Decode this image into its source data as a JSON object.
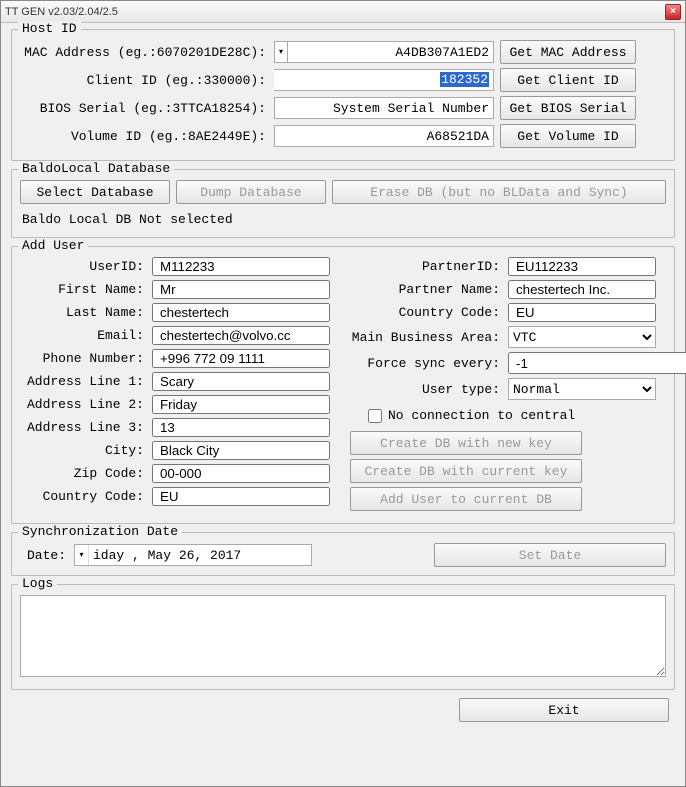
{
  "window_title": "TT GEN v2.03/2.04/2.5",
  "host": {
    "group_title": "Host ID",
    "mac_label": "MAC Address (eg.:6070201DE28C):",
    "mac_value": "A4DB307A1ED2",
    "mac_btn": "Get MAC Address",
    "client_label": "Client ID (eg.:330000):",
    "client_value": "182352",
    "client_btn": "Get Client ID",
    "bios_label": "BIOS Serial (eg.:3TTCA18254):",
    "bios_value": "System Serial Number",
    "bios_btn": "Get BIOS Serial",
    "vol_label": "Volume ID (eg.:8AE2449E):",
    "vol_value": "A68521DA",
    "vol_btn": "Get Volume ID"
  },
  "db": {
    "group_title": "BaldoLocal Database",
    "select_btn": "Select Database",
    "dump_btn": "Dump Database",
    "erase_btn": "Erase DB (but no BLData and Sync)",
    "status": "Baldo Local DB Not selected"
  },
  "adduser": {
    "group_title": "Add User",
    "labels": {
      "userid": "UserID:",
      "first": "First Name:",
      "last": "Last Name:",
      "email": "Email:",
      "phone": "Phone Number:",
      "addr1": "Address Line 1:",
      "addr2": "Address Line 2:",
      "addr3": "Address Line 3:",
      "city": "City:",
      "zip": "Zip Code:",
      "ccode": "Country Code:",
      "partnerid": "PartnerID:",
      "pname": "Partner Name:",
      "pccode": "Country Code:",
      "mba": "Main Business Area:",
      "sync": "Force sync every:",
      "utype": "User type:"
    },
    "values": {
      "userid": "M112233",
      "first": "Mr",
      "last": "chestertech",
      "email": "chestertech@volvo.cc",
      "phone": "+996 772 09 1111",
      "addr1": "Scary",
      "addr2": "Friday",
      "addr3": "13",
      "city": "Black City",
      "zip": "00-000",
      "ccode": "EU",
      "partnerid": "EU112233",
      "pname": "chestertech Inc.",
      "pccode": "EU",
      "mba": "VTC",
      "sync": "-1",
      "utype": "Normal"
    },
    "no_conn": "No connection to central",
    "btn_new": "Create DB with new key",
    "btn_cur": "Create DB with current key",
    "btn_add": "Add User to current DB"
  },
  "syncdate": {
    "group_title": "Synchronization Date",
    "label": "Date:",
    "value": "iday ,   May   26, 2017",
    "btn": "Set Date"
  },
  "logs": {
    "group_title": "Logs"
  },
  "exit": "Exit"
}
